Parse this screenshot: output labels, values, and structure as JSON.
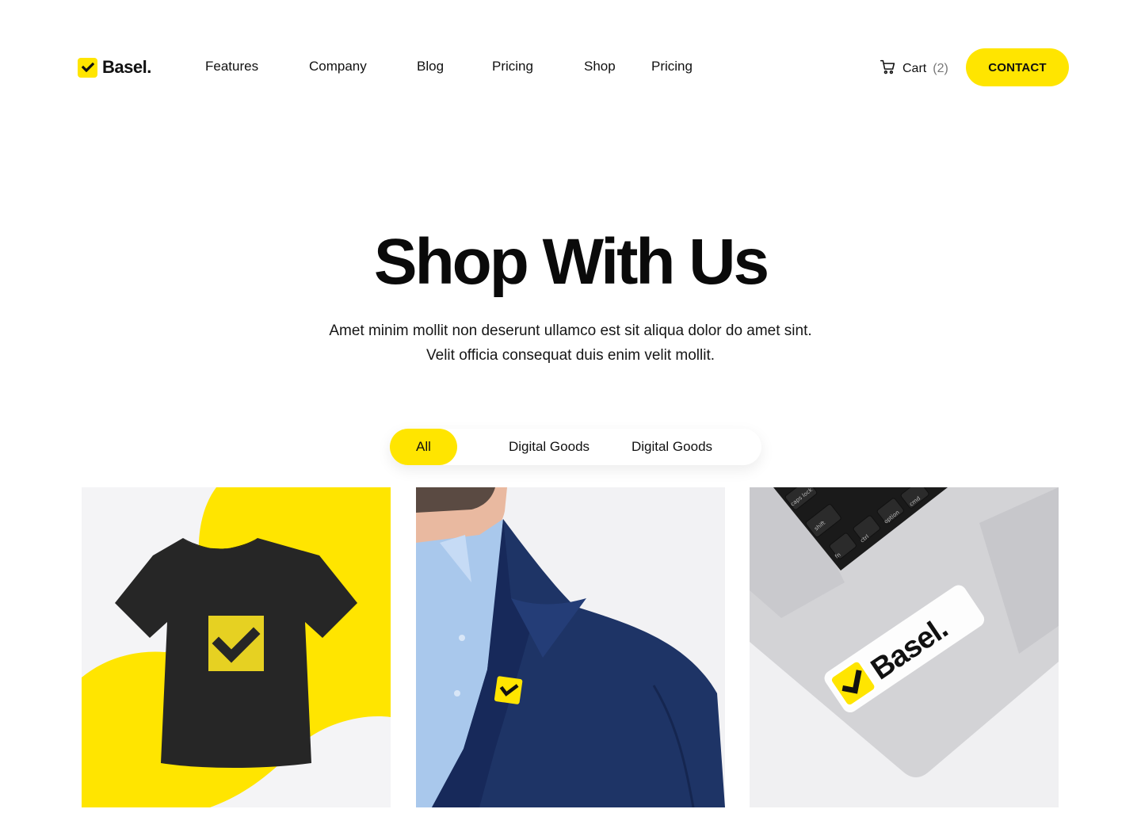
{
  "brand": {
    "name": "Basel.",
    "logo_icon": "check-icon",
    "accent": "#FFE500"
  },
  "nav": {
    "items": [
      {
        "label": "Features"
      },
      {
        "label": "Company"
      },
      {
        "label": "Blog"
      },
      {
        "label": "Pricing"
      },
      {
        "label": "Shop"
      },
      {
        "label": "Pricing"
      }
    ]
  },
  "cart": {
    "label": "Cart",
    "count": "(2)",
    "icon": "cart-icon"
  },
  "contact": {
    "label": "CONTACT"
  },
  "hero": {
    "title": "Shop With Us",
    "subtitle_line1": "Amet minim mollit non deserunt ullamco est sit aliqua dolor do amet sint.",
    "subtitle_line2": "Velit officia consequat duis enim velit mollit."
  },
  "filters": {
    "tabs": [
      {
        "label": "All",
        "active": true
      },
      {
        "label": "Digital Goods",
        "active": false
      },
      {
        "label": "Digital Goods",
        "active": false
      }
    ]
  },
  "products": [
    {
      "name": "t-shirt",
      "image": "black t-shirt with yellow check logo on yellow blob background"
    },
    {
      "name": "pin",
      "image": "man in navy blazer wearing yellow check pin"
    },
    {
      "name": "sticker",
      "image": "Basel. sticker on silver laptop near keyboard",
      "sticker_text": "Basel.",
      "keys": [
        "caps lock",
        "shift",
        "fn",
        "ctrl",
        "option",
        "cmd"
      ]
    }
  ]
}
